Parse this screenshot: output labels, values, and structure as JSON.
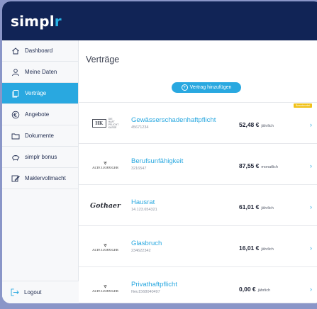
{
  "brand": {
    "name_prefix": "simpl",
    "name_suffix": "r",
    "colors": {
      "header_bg": "#112456",
      "accent": "#29a8e0",
      "badge": "#f0c11a"
    }
  },
  "sidebar": {
    "items": [
      {
        "label": "Dashboard",
        "icon": "home-icon"
      },
      {
        "label": "Meine Daten",
        "icon": "user-icon"
      },
      {
        "label": "Verträge",
        "icon": "documents-icon",
        "active": true
      },
      {
        "label": "Angebote",
        "icon": "euro-icon"
      },
      {
        "label": "Dokumente",
        "icon": "folder-icon"
      },
      {
        "label": "simplr bonus",
        "icon": "piggy-bank-icon"
      },
      {
        "label": "Maklervollmacht",
        "icon": "signature-icon"
      }
    ],
    "logout_label": "Logout"
  },
  "main": {
    "title": "Verträge",
    "add_button_label": "Vertrag hinzufügen",
    "contracts": [
      {
        "insurer": "HK DIE HAFTPFLICHT KASSE",
        "name": "Gewässerschadenhaftpflicht",
        "number": "45671234",
        "amount": "52,48 €",
        "period": "jährlich",
        "badge": "Beantwortet"
      },
      {
        "insurer": "ALTE LEIPZIGER",
        "name": "Berufsunfähigkeit",
        "number": "3216547",
        "amount": "87,55 €",
        "period": "monatlich"
      },
      {
        "insurer": "Gothaer",
        "name": "Hausrat",
        "number": "14.123.654321",
        "amount": "61,01 €",
        "period": "jährlich"
      },
      {
        "insurer": "ALTE LEIPZIGER",
        "name": "Glasbruch",
        "number": "234622342",
        "amount": "16,01 €",
        "period": "jährlich"
      },
      {
        "insurer": "ALTE LEIPZIGER",
        "name": "Privathaftpflicht",
        "number": "Neu1568040497",
        "amount": "0,00 €",
        "period": "jährlich"
      }
    ],
    "hk_logo": {
      "box": "HK",
      "line1": "DIE",
      "line2": "HAFT",
      "line3": "PFLICHT",
      "line4": "KASSE"
    }
  }
}
